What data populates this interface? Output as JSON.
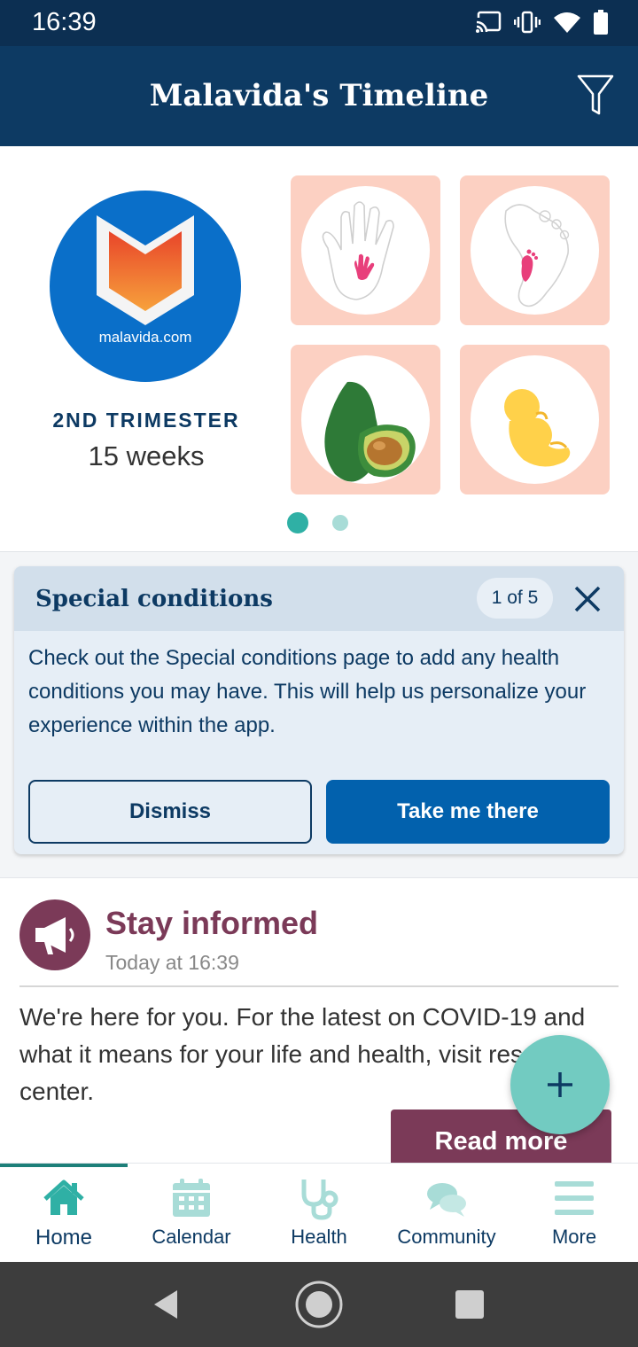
{
  "status_bar": {
    "time": "16:39",
    "icons": [
      "cast-icon",
      "vibrate-icon",
      "wifi-icon",
      "battery-icon"
    ]
  },
  "app_bar": {
    "title": "Malavida's Timeline",
    "filter_icon": "filter-icon"
  },
  "hero": {
    "logo_text": "malavida.com",
    "trimester": "2ND TRIMESTER",
    "weeks": "15 weeks",
    "tiles": [
      "baby-hand-icon",
      "baby-foot-icon",
      "avocado-icon",
      "fetus-icon"
    ],
    "pager": {
      "current": 1,
      "total": 2
    }
  },
  "special_card": {
    "title": "Special conditions",
    "counter": "1 of 5",
    "body": "Check out the Special conditions page to add any health conditions you may have. This will help us personalize your experience within the app.",
    "dismiss_label": "Dismiss",
    "take_label": "Take me there"
  },
  "feed": {
    "title": "Stay informed",
    "time": "Today at 16:39",
    "text": "We're here for you. For the latest on COVID-19 and what it means for your life and health, visit resource center.",
    "read_more": "Read more"
  },
  "fab": {
    "icon": "plus-icon"
  },
  "bottom_nav": {
    "items": [
      {
        "label": "Home",
        "icon": "home-icon",
        "active": true
      },
      {
        "label": "Calendar",
        "icon": "calendar-icon",
        "active": false
      },
      {
        "label": "Health",
        "icon": "stethoscope-icon",
        "active": false
      },
      {
        "label": "Community",
        "icon": "chat-bubbles-icon",
        "active": false
      },
      {
        "label": "More",
        "icon": "menu-icon",
        "active": false
      }
    ]
  },
  "colors": {
    "app_bar": "#0d3a63",
    "status_bar": "#0c2f52",
    "teal": "#2fb0a5",
    "plum": "#7b3a58",
    "primary_button": "#0261ad",
    "tile_bg": "#fcd0c2"
  }
}
